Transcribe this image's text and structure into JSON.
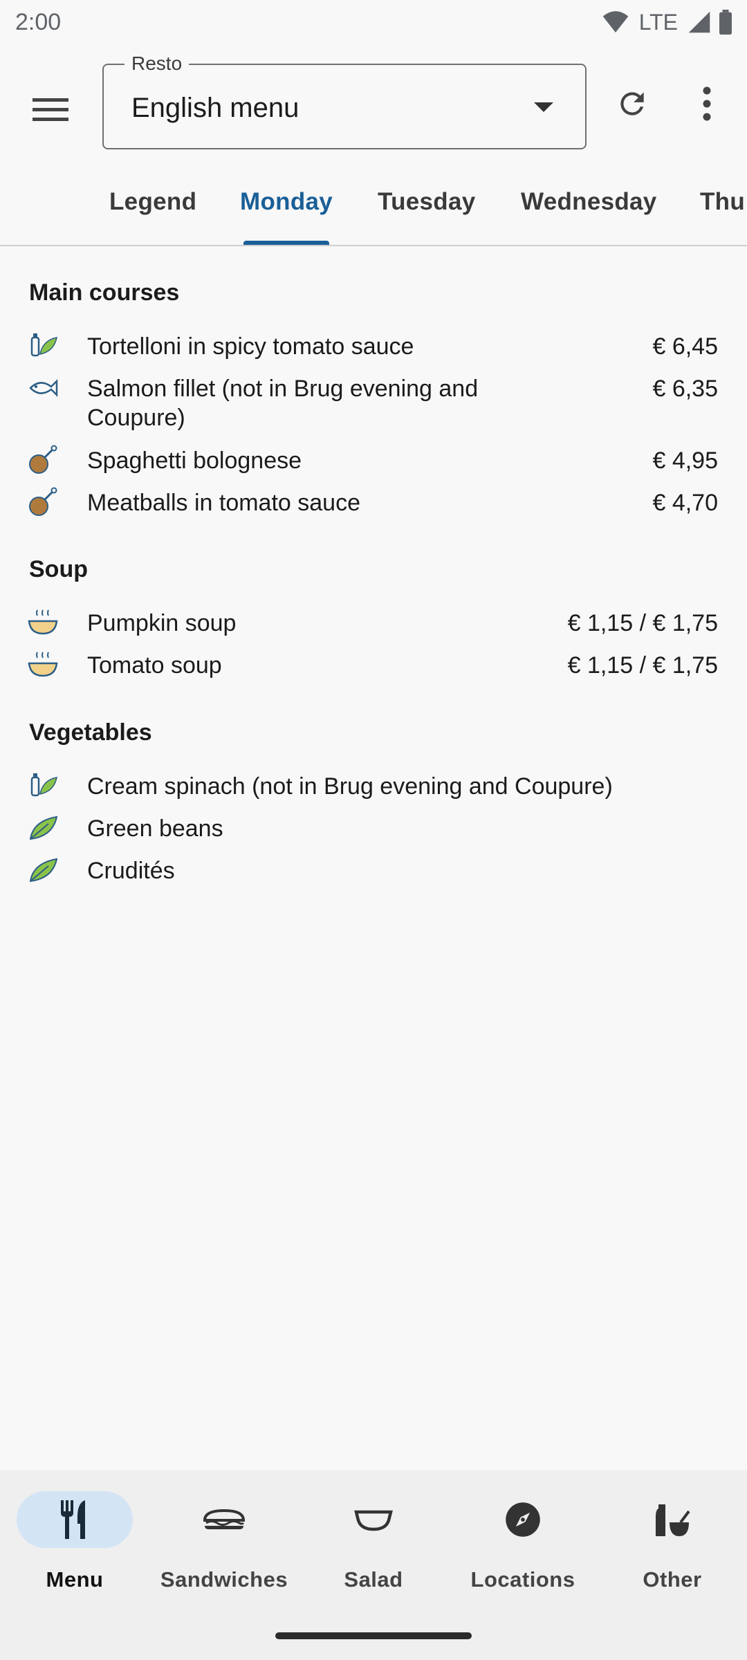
{
  "status_bar": {
    "time": "2:00",
    "network": "LTE"
  },
  "app_bar": {
    "resto_label": "Resto",
    "resto_value": "English menu"
  },
  "tabs": [
    {
      "label": "Legend"
    },
    {
      "label": "Monday"
    },
    {
      "label": "Tuesday"
    },
    {
      "label": "Wednesday"
    },
    {
      "label": "Thu"
    }
  ],
  "active_tab": "Monday",
  "sections": {
    "main": {
      "title": "Main courses",
      "items": [
        {
          "name": "Tortelloni in spicy tomato sauce",
          "price": "€ 6,45",
          "icon": "vegan-icon"
        },
        {
          "name": "Salmon fillet (not in Brug evening and Coupure)",
          "price": "€ 6,35",
          "icon": "fish-icon"
        },
        {
          "name": "Spaghetti bolognese",
          "price": "€ 4,95",
          "icon": "meat-icon"
        },
        {
          "name": "Meatballs in tomato sauce",
          "price": "€ 4,70",
          "icon": "meat-icon"
        }
      ]
    },
    "soup": {
      "title": "Soup",
      "items": [
        {
          "name": "Pumpkin soup",
          "price": "€ 1,15 / € 1,75",
          "icon": "soup-icon"
        },
        {
          "name": "Tomato soup",
          "price": "€ 1,15 / € 1,75",
          "icon": "soup-icon"
        }
      ]
    },
    "vegetables": {
      "title": "Vegetables",
      "items": [
        {
          "name": "Cream spinach (not in Brug evening and Coupure)",
          "icon": "vegan-icon"
        },
        {
          "name": "Green beans",
          "icon": "leaf-icon"
        },
        {
          "name": "Crudités",
          "icon": "leaf-icon"
        }
      ]
    }
  },
  "bottom_nav": [
    {
      "label": "Menu",
      "icon": "cutlery-icon",
      "active": true
    },
    {
      "label": "Sandwiches",
      "icon": "sandwich-icon",
      "active": false
    },
    {
      "label": "Salad",
      "icon": "bowl-icon",
      "active": false
    },
    {
      "label": "Locations",
      "icon": "compass-icon",
      "active": false
    },
    {
      "label": "Other",
      "icon": "bottle-icon",
      "active": false
    }
  ],
  "colors": {
    "accent": "#1a5f97",
    "nav_active_bg": "#d3e4f5",
    "leaf_green": "#8bc34a",
    "icon_blue": "#2c5e86",
    "meat_brown": "#b07a3c"
  }
}
